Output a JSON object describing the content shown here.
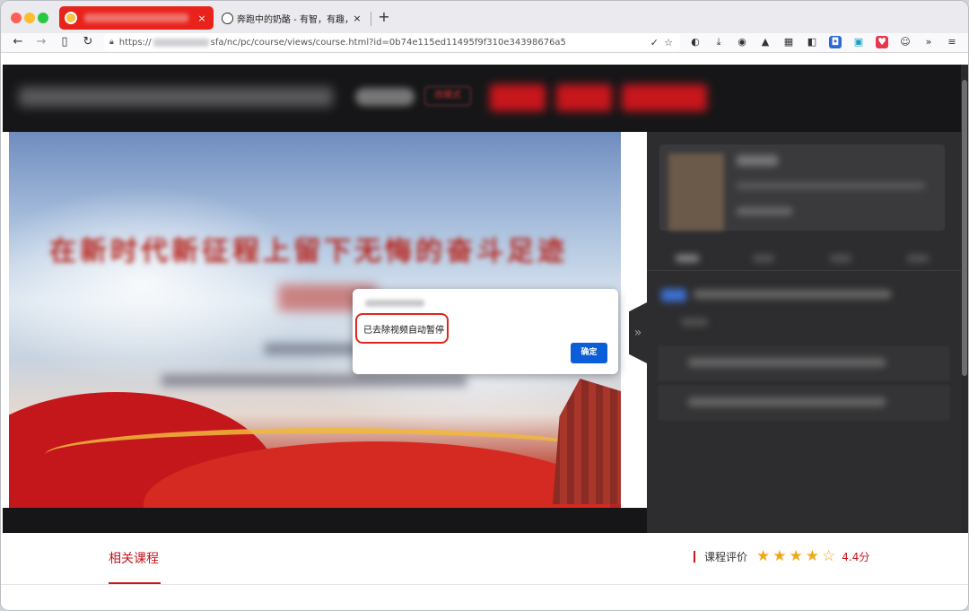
{
  "browser": {
    "active_tab": {
      "close": "×"
    },
    "second_tab": {
      "title": "奔跑中的奶酪 - 有智，有趣，有爱",
      "close": "×"
    },
    "new_tab": "+",
    "nav": {
      "back": "←",
      "forward": "→",
      "sidebar": "▯",
      "reload": "↻"
    },
    "url": {
      "prefix": "https://",
      "path": "sfa/nc/pc/course/views/course.html?id=0b74e115ed11495f9f310e34398676a5"
    },
    "url_icons": {
      "check": "✓",
      "bookmark": "☆"
    },
    "toolbar_overflow": "»",
    "menu": "≡"
  },
  "page": {
    "header_mode_button": "改模式",
    "video_title": "在新时代新征程上留下无悔的奋斗足迹",
    "collapse_icon": "»"
  },
  "dialog": {
    "message": "已去除视频自动暂停",
    "ok_label": "确定"
  },
  "bottom": {
    "related_label": "相关课程",
    "rating_label": "课程评价",
    "rating_value": 4.4,
    "rating_text": "4.4分",
    "stars": [
      "★",
      "★",
      "★",
      "★",
      "☆"
    ]
  },
  "colors": {
    "accent_red": "#c8161d",
    "tab_red": "#e8231c",
    "dialog_button": "#0b5ed7",
    "star": "#f0a81a"
  }
}
